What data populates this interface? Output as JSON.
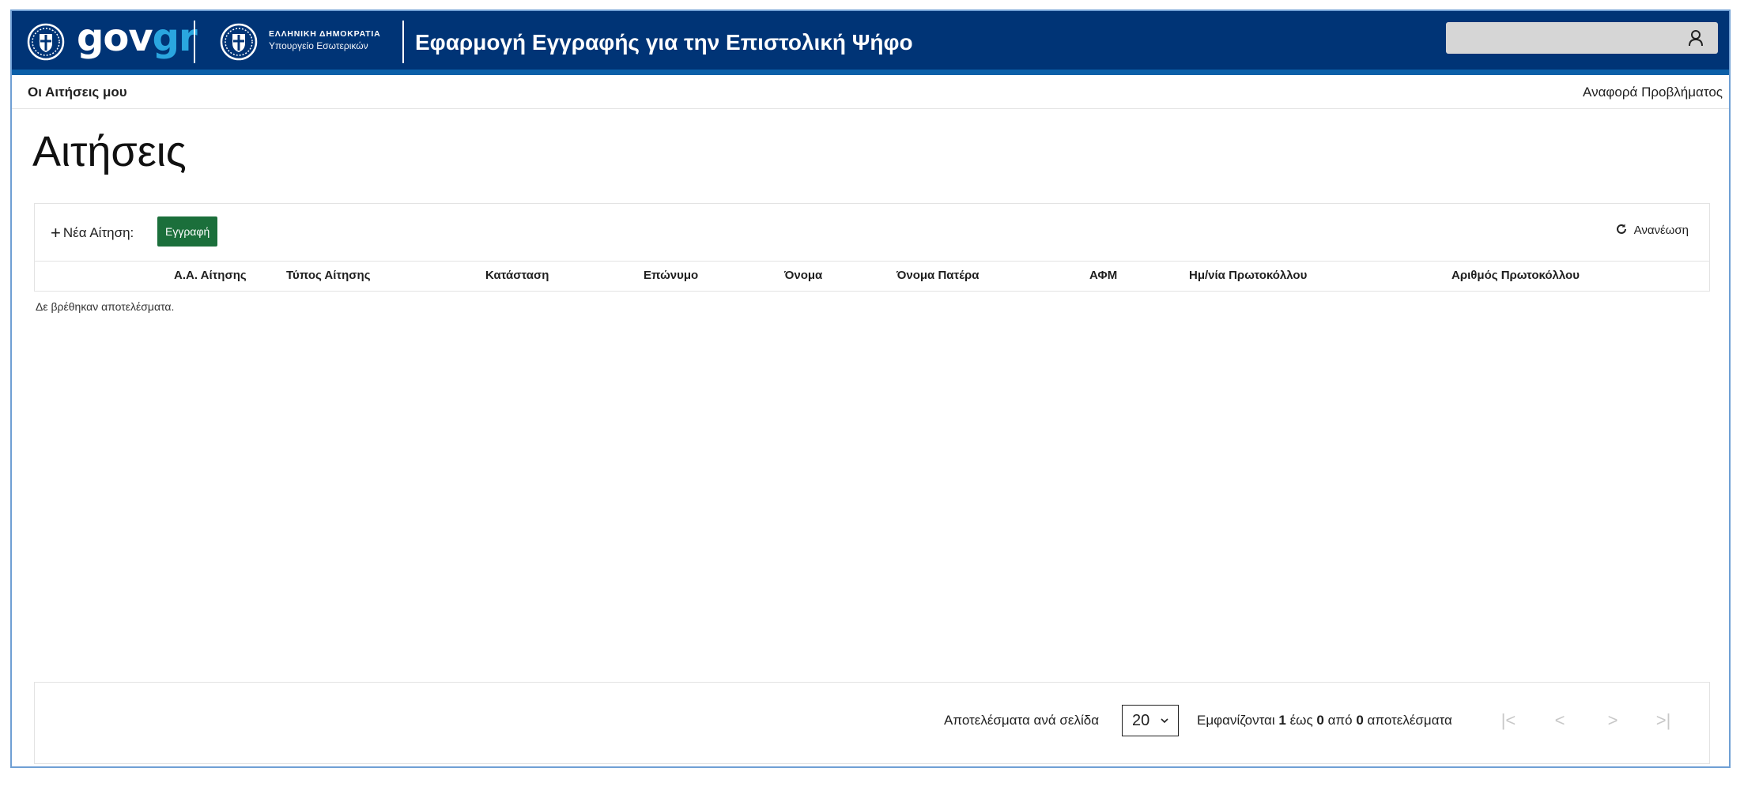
{
  "header": {
    "logo_part1": "gov",
    "logo_part2": "gr",
    "ministry_line1": "ΕΛΛΗΝΙΚΗ ΔΗΜΟΚΡΑΤΙΑ",
    "ministry_line2": "Υπουργείο Εσωτερικών",
    "app_title": "Εφαρμογή Εγγραφής για την Επιστολική Ψήφο",
    "user_icon": "user-icon"
  },
  "subnav": {
    "my_applications": "Οι Αιτήσεις μου",
    "report_problem": "Αναφορά Προβλήματος"
  },
  "page": {
    "title": "Αιτήσεις"
  },
  "toolbar": {
    "plus": "+",
    "new_application_label": "Νέα Αίτηση:",
    "register_button": "Εγγραφή",
    "refresh_label": "Ανανέωση"
  },
  "table": {
    "columns": [
      "Α.Α. Αίτησης",
      "Τύπος Αίτησης",
      "Κατάσταση",
      "Επώνυμο",
      "Όνομα",
      "Όνομα Πατέρα",
      "ΑΦΜ",
      "Ημ/νία Πρωτοκόλλου",
      "Αριθμός Πρωτοκόλλου"
    ],
    "empty_message": "Δε βρέθηκαν αποτελέσματα."
  },
  "pagination": {
    "per_page_label": "Αποτελέσματα ανά σελίδα",
    "per_page_value": "20",
    "range_prefix": "Εμφανίζονται",
    "range_from": "1",
    "range_mid": "έως",
    "range_to": "0",
    "range_of": "από",
    "range_total": "0",
    "range_suffix": "αποτελέσματα",
    "first": "|<",
    "prev": "<",
    "next": ">",
    "last": ">|"
  },
  "colors": {
    "header_bg": "#003476",
    "header_stripe": "#0b5fa8",
    "logo_accent": "#2aa6df",
    "register_button_bg": "#1b6f3b"
  }
}
